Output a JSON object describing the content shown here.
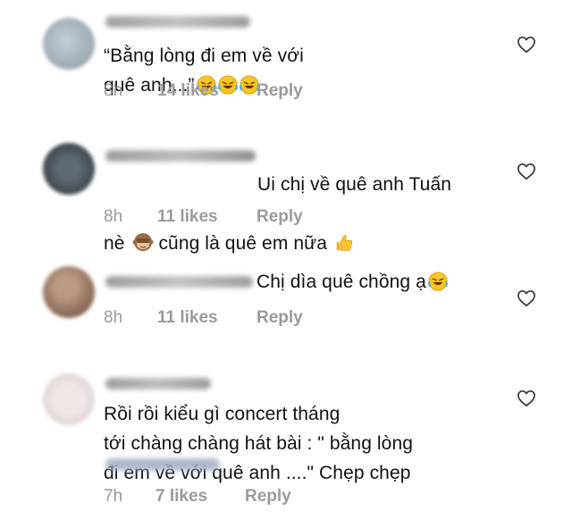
{
  "comments": [
    {
      "text": "“Bằng lòng đi em về với\nquê anh...”",
      "time": "8h",
      "likes": "14 likes",
      "reply": "Reply"
    },
    {
      "text_line1": "Ui chị về quê anh Tuấn",
      "text_line2_a": "nè",
      "text_line2_b": "cũng là quê em nữa",
      "time": "8h",
      "likes": "11 likes",
      "reply": "Reply"
    },
    {
      "text": "Chị dìa quê chồng ạ",
      "time": "8h",
      "likes": "11 likes",
      "reply": "Reply"
    },
    {
      "text": "Rồi rồi kiểu gì concert tháng\ntới chàng chàng hát bài : \" bằng lòng\nđi em về với quê anh ....\" Chẹp chẹp",
      "time": "7h",
      "likes": "7 likes",
      "reply": "Reply"
    }
  ],
  "icons": {
    "heart": "heart-outline-icon",
    "laugh": "laughing-tears-emoji",
    "monkey": "see-no-evil-monkey-emoji",
    "thumbs": "thumbs-up-emoji"
  },
  "colors": {
    "meta": "#9a9a9a",
    "text": "#111111"
  }
}
